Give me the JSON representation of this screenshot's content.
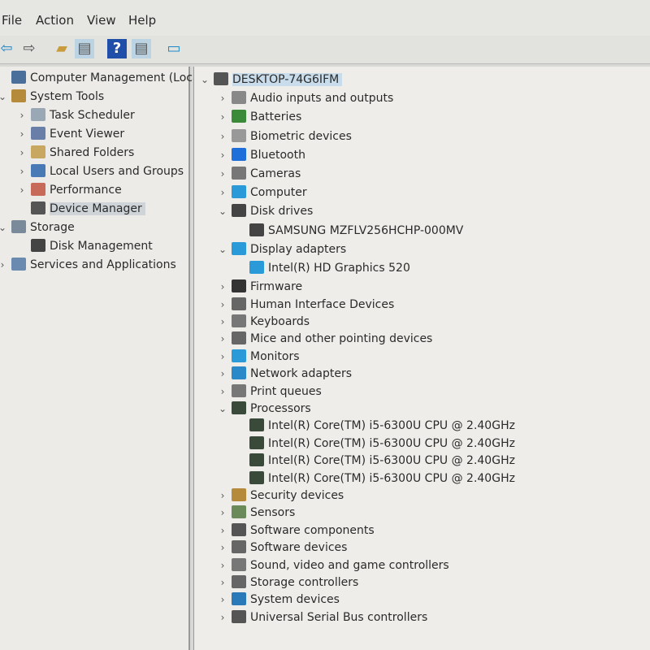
{
  "menu": [
    "File",
    "Action",
    "View",
    "Help"
  ],
  "toolbar": [
    {
      "icon": "back-arrow-icon",
      "glyph": "⇦",
      "color": "#1e88c8"
    },
    {
      "icon": "forward-arrow-icon",
      "glyph": "⇨",
      "color": "#555"
    },
    {
      "icon": "up-folder-icon",
      "glyph": "▰",
      "color": "#c89b3c"
    },
    {
      "icon": "show-hide-console-tree-icon",
      "glyph": "▤",
      "color": "#555"
    },
    {
      "icon": "help-icon",
      "glyph": "?",
      "color": "#fff"
    },
    {
      "icon": "properties-icon",
      "glyph": "▤",
      "color": "#555"
    },
    {
      "icon": "monitor-icon",
      "glyph": "▭",
      "color": "#1e88c8"
    }
  ],
  "left_tree": [
    {
      "label": "Computer Management (Local)",
      "level": 0,
      "chev": "",
      "icon": "computer-management-icon",
      "color": "#4a6f9a"
    },
    {
      "label": "System Tools",
      "level": 0,
      "chev": "⌄",
      "icon": "tools-icon",
      "color": "#b58a3a"
    },
    {
      "label": "Task Scheduler",
      "level": 1,
      "chev": "›",
      "icon": "clock-icon",
      "color": "#9aa7b5"
    },
    {
      "label": "Event Viewer",
      "level": 1,
      "chev": "›",
      "icon": "event-viewer-icon",
      "color": "#6a7fa8"
    },
    {
      "label": "Shared Folders",
      "level": 1,
      "chev": "›",
      "icon": "shared-folder-icon",
      "color": "#c8a860"
    },
    {
      "label": "Local Users and Groups",
      "level": 1,
      "chev": "›",
      "icon": "users-icon",
      "color": "#4a7ab5"
    },
    {
      "label": "Performance",
      "level": 1,
      "chev": "›",
      "icon": "performance-icon",
      "color": "#c86a5a"
    },
    {
      "label": "Device Manager",
      "level": 1,
      "chev": "",
      "icon": "device-manager-icon",
      "color": "#555",
      "selected": true
    },
    {
      "label": "Storage",
      "level": 0,
      "chev": "⌄",
      "icon": "storage-icon",
      "color": "#7a8a9a"
    },
    {
      "label": "Disk Management",
      "level": 1,
      "chev": "",
      "icon": "disk-icon",
      "color": "#444"
    },
    {
      "label": "Services and Applications",
      "level": 0,
      "chev": "›",
      "icon": "services-icon",
      "color": "#6a8ab0"
    }
  ],
  "device_tree": [
    {
      "label": "DESKTOP-74G6IFM",
      "level": 0,
      "chev": "⌄",
      "icon": "computer-icon",
      "color": "#555",
      "selected": true
    },
    {
      "label": "Audio inputs and outputs",
      "level": 1,
      "chev": "›",
      "icon": "speaker-icon",
      "color": "#888"
    },
    {
      "label": "Batteries",
      "level": 1,
      "chev": "›",
      "icon": "battery-icon",
      "color": "#3a8a3a"
    },
    {
      "label": "Biometric devices",
      "level": 1,
      "chev": "›",
      "icon": "biometric-icon",
      "color": "#999"
    },
    {
      "label": "Bluetooth",
      "level": 1,
      "chev": "›",
      "icon": "bluetooth-icon",
      "color": "#1e6fd9"
    },
    {
      "label": "Cameras",
      "level": 1,
      "chev": "›",
      "icon": "camera-icon",
      "color": "#777"
    },
    {
      "label": "Computer",
      "level": 1,
      "chev": "›",
      "icon": "monitor-icon",
      "color": "#2a9ad9"
    },
    {
      "label": "Disk drives",
      "level": 1,
      "chev": "⌄",
      "icon": "disk-drive-icon",
      "color": "#444"
    },
    {
      "label": "SAMSUNG MZFLV256HCHP-000MV",
      "level": 2,
      "chev": "",
      "icon": "disk-drive-icon",
      "color": "#444"
    },
    {
      "label": "Display adapters",
      "level": 1,
      "chev": "⌄",
      "icon": "display-adapter-icon",
      "color": "#2a9ad9"
    },
    {
      "label": "Intel(R) HD Graphics 520",
      "level": 2,
      "chev": "",
      "icon": "display-adapter-icon",
      "color": "#2a9ad9"
    },
    {
      "label": "Firmware",
      "level": 1,
      "chev": "›",
      "icon": "firmware-icon",
      "color": "#333"
    },
    {
      "label": "Human Interface Devices",
      "level": 1,
      "chev": "›",
      "icon": "hid-icon",
      "color": "#666"
    },
    {
      "label": "Keyboards",
      "level": 1,
      "chev": "›",
      "icon": "keyboard-icon",
      "color": "#777"
    },
    {
      "label": "Mice and other pointing devices",
      "level": 1,
      "chev": "›",
      "icon": "mouse-icon",
      "color": "#666"
    },
    {
      "label": "Monitors",
      "level": 1,
      "chev": "›",
      "icon": "monitor-icon",
      "color": "#2a9ad9"
    },
    {
      "label": "Network adapters",
      "level": 1,
      "chev": "›",
      "icon": "network-icon",
      "color": "#2a8ac9"
    },
    {
      "label": "Print queues",
      "level": 1,
      "chev": "›",
      "icon": "printer-icon",
      "color": "#777"
    },
    {
      "label": "Processors",
      "level": 1,
      "chev": "⌄",
      "icon": "processor-icon",
      "color": "#3a4a3a"
    },
    {
      "label": "Intel(R) Core(TM) i5-6300U CPU @ 2.40GHz",
      "level": 2,
      "chev": "",
      "icon": "processor-icon",
      "color": "#3a4a3a"
    },
    {
      "label": "Intel(R) Core(TM) i5-6300U CPU @ 2.40GHz",
      "level": 2,
      "chev": "",
      "icon": "processor-icon",
      "color": "#3a4a3a"
    },
    {
      "label": "Intel(R) Core(TM) i5-6300U CPU @ 2.40GHz",
      "level": 2,
      "chev": "",
      "icon": "processor-icon",
      "color": "#3a4a3a"
    },
    {
      "label": "Intel(R) Core(TM) i5-6300U CPU @ 2.40GHz",
      "level": 2,
      "chev": "",
      "icon": "processor-icon",
      "color": "#3a4a3a"
    },
    {
      "label": "Security devices",
      "level": 1,
      "chev": "›",
      "icon": "security-icon",
      "color": "#b58a3a"
    },
    {
      "label": "Sensors",
      "level": 1,
      "chev": "›",
      "icon": "sensor-icon",
      "color": "#6a8a5a"
    },
    {
      "label": "Software components",
      "level": 1,
      "chev": "›",
      "icon": "software-component-icon",
      "color": "#555"
    },
    {
      "label": "Software devices",
      "level": 1,
      "chev": "›",
      "icon": "software-device-icon",
      "color": "#666"
    },
    {
      "label": "Sound, video and game controllers",
      "level": 1,
      "chev": "›",
      "icon": "sound-icon",
      "color": "#777"
    },
    {
      "label": "Storage controllers",
      "level": 1,
      "chev": "›",
      "icon": "storage-controller-icon",
      "color": "#666"
    },
    {
      "label": "System devices",
      "level": 1,
      "chev": "›",
      "icon": "system-device-icon",
      "color": "#2a7ab9"
    },
    {
      "label": "Universal Serial Bus controllers",
      "level": 1,
      "chev": "›",
      "icon": "usb-icon",
      "color": "#555"
    }
  ]
}
